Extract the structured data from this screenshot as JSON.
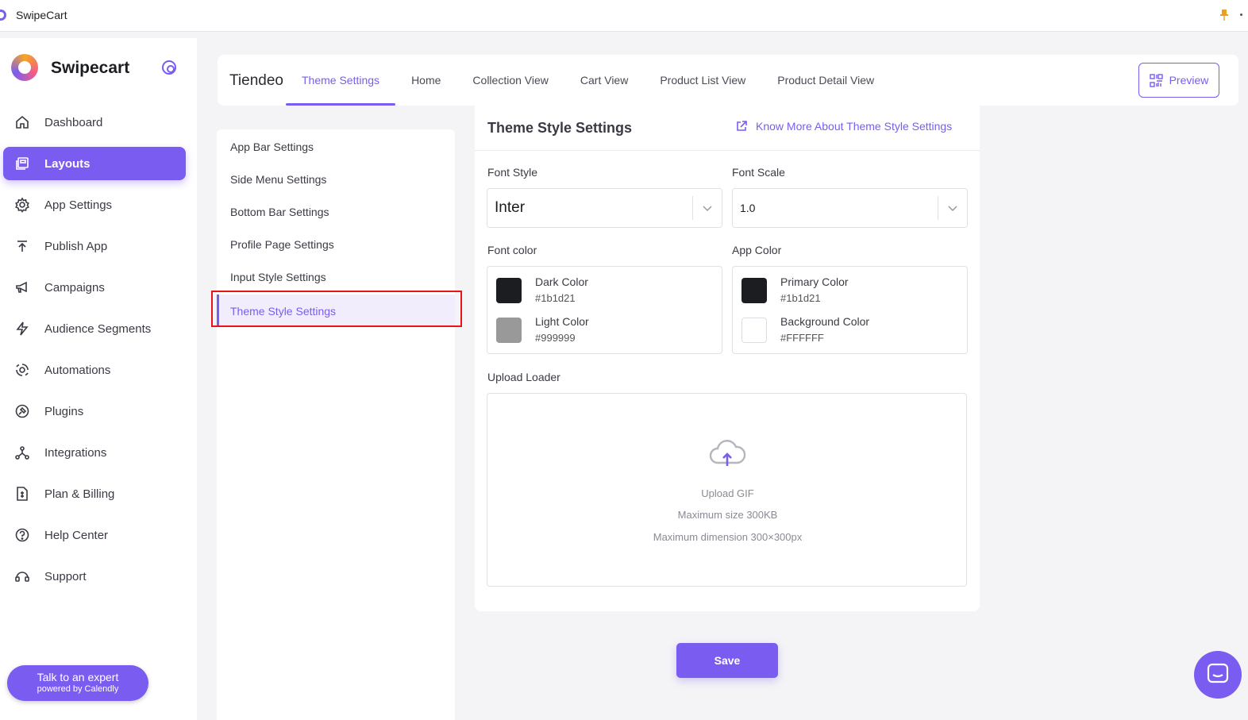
{
  "window": {
    "title": "SwipeCart"
  },
  "brand": {
    "name": "Swipecart"
  },
  "sidebar": {
    "items": [
      {
        "label": "Dashboard",
        "icon": "home-icon"
      },
      {
        "label": "Layouts",
        "icon": "layouts-icon",
        "active": true
      },
      {
        "label": "App Settings",
        "icon": "gear-icon"
      },
      {
        "label": "Publish App",
        "icon": "upload-icon"
      },
      {
        "label": "Campaigns",
        "icon": "megaphone-icon"
      },
      {
        "label": "Audience Segments",
        "icon": "lightning-icon"
      },
      {
        "label": "Automations",
        "icon": "automation-icon"
      },
      {
        "label": "Plugins",
        "icon": "plugin-icon"
      },
      {
        "label": "Integrations",
        "icon": "integrations-icon"
      },
      {
        "label": "Plan & Billing",
        "icon": "billing-icon"
      },
      {
        "label": "Help Center",
        "icon": "help-icon"
      },
      {
        "label": "Support",
        "icon": "support-icon"
      }
    ],
    "expert": {
      "line1": "Talk to an expert",
      "line2": "powered by Calendly"
    }
  },
  "header": {
    "store_name": "Tiendeo",
    "tabs": [
      {
        "label": "Theme Settings",
        "active": true
      },
      {
        "label": "Home"
      },
      {
        "label": "Collection View"
      },
      {
        "label": "Cart View"
      },
      {
        "label": "Product List View"
      },
      {
        "label": "Product Detail View"
      }
    ],
    "preview_label": "Preview"
  },
  "settings_menu": {
    "items": [
      {
        "label": "App Bar Settings"
      },
      {
        "label": "Side Menu Settings"
      },
      {
        "label": "Bottom Bar Settings"
      },
      {
        "label": "Profile Page Settings"
      },
      {
        "label": "Input Style Settings"
      },
      {
        "label": "Theme Style Settings",
        "active": true
      }
    ]
  },
  "panel": {
    "title": "Theme Style Settings",
    "know_more": "Know More About Theme Style Settings",
    "font_style": {
      "label": "Font Style",
      "value": "Inter"
    },
    "font_scale": {
      "label": "Font Scale",
      "value": "1.0"
    },
    "font_color": {
      "label": "Font color",
      "colors": [
        {
          "name": "Dark Color",
          "hex": "#1b1d21",
          "swatch": "#1b1d21"
        },
        {
          "name": "Light Color",
          "hex": "#999999",
          "swatch": "#999999"
        }
      ]
    },
    "app_color": {
      "label": "App Color",
      "colors": [
        {
          "name": "Primary Color",
          "hex": "#1b1d21",
          "swatch": "#1b1d21"
        },
        {
          "name": "Background Color",
          "hex": "#FFFFFF",
          "swatch": "#FFFFFF"
        }
      ]
    },
    "upload": {
      "label": "Upload Loader",
      "title": "Upload GIF",
      "size": "Maximum size 300KB",
      "dimension": "Maximum dimension 300×300px"
    }
  },
  "save_label": "Save",
  "colors": {
    "accent": "#7b5cf0",
    "highlight": "#e8141b"
  }
}
